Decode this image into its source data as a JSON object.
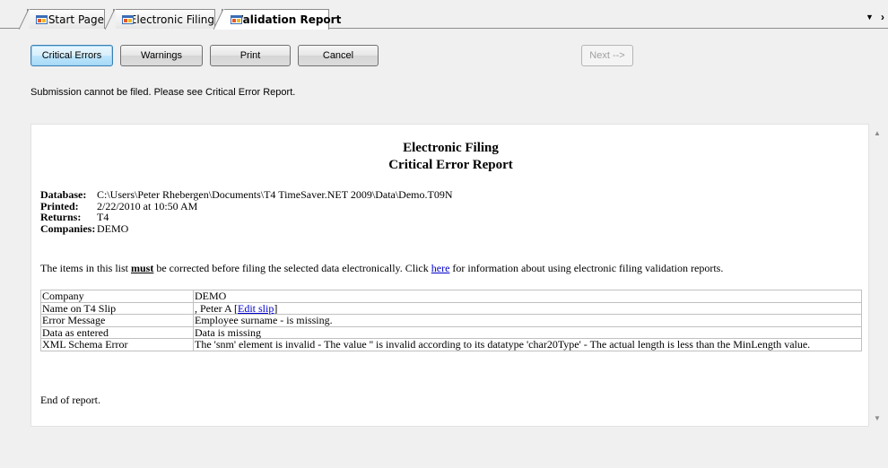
{
  "tabs": [
    {
      "label": "Start Page",
      "active": false
    },
    {
      "label": "Electronic Filing",
      "active": false
    },
    {
      "label": "Validation Report",
      "active": true
    }
  ],
  "toolbar": {
    "critical_errors": "Critical Errors",
    "warnings": "Warnings",
    "print": "Print",
    "cancel": "Cancel",
    "next": "Next -->"
  },
  "status_message": "Submission cannot be filed. Please see Critical Error Report.",
  "report": {
    "title": "Electronic Filing",
    "subtitle": "Critical Error Report",
    "meta": [
      {
        "key": "Database:",
        "value": "C:\\Users\\Peter Rhebergen\\Documents\\T4 TimeSaver.NET 2009\\Data\\Demo.T09N"
      },
      {
        "key": "Printed:",
        "value": "2/22/2010 at 10:50 AM"
      },
      {
        "key": "Returns:",
        "value": "T4"
      },
      {
        "key": "Companies:",
        "value": "DEMO"
      }
    ],
    "intro_before": "The items in this list ",
    "intro_must": "must",
    "intro_middle": " be corrected before filing the selected data electronically. Click ",
    "intro_link": "here",
    "intro_after": " for information about using electronic filing validation reports.",
    "rows": {
      "company_key": "Company",
      "company_val": "DEMO",
      "slip_key": "Name on T4 Slip",
      "slip_val": ", Peter A [",
      "slip_link": "Edit slip",
      "slip_close": "]",
      "error_key": "Error Message",
      "error_val": "Employee surname - is missing.",
      "entered_key": "Data as entered",
      "entered_val": "Data is missing",
      "schema_key": "XML Schema Error",
      "schema_val": "The 'snm' element is invalid - The value '' is invalid according to its datatype 'char20Type' - The actual length is less than the MinLength value."
    },
    "end": "End of report."
  },
  "colors": {
    "link": "#0000cc",
    "focus": "#3c7fb1"
  },
  "icons": {
    "tab_icon": "window-app-icon",
    "dropdown": "chevron-down-icon",
    "scroll_right": "chevron-right-icon"
  }
}
